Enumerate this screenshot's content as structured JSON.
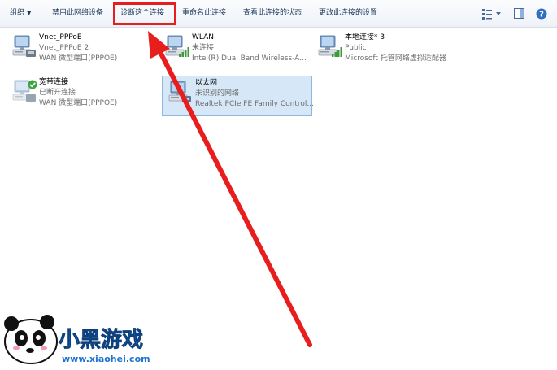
{
  "toolbar": {
    "organize": "组织",
    "disable": "禁用此网络设备",
    "diagnose": "诊断这个连接",
    "rename": "重命名此连接",
    "view_status": "查看此连接的状态",
    "change_settings": "更改此连接的设置",
    "view_caret": "▼",
    "help": "?"
  },
  "connections": [
    {
      "name": "Vnet_PPPoE",
      "status": "Vnet_PPPoE  2",
      "adapter": "WAN 微型端口(PPPOE)"
    },
    {
      "name": "WLAN",
      "status": "未连接",
      "adapter": "Intel(R) Dual Band Wireless-A..."
    },
    {
      "name": "本地连接* 3",
      "status": "Public",
      "adapter": "Microsoft 托管网络虚拟适配器"
    },
    {
      "name": "宽带连接",
      "status": "已断开连接",
      "adapter": "WAN 微型端口(PPPOE)"
    },
    {
      "name": "以太网",
      "status": "未识别的网络",
      "adapter": "Realtek PCIe FE Family Control..."
    }
  ],
  "watermark": {
    "brand": "小黑游戏",
    "url": "www.xiaohei.com"
  },
  "colors": {
    "accent": "#e81e1e",
    "selection": "#d6e7f7",
    "toolbar_text": "#1e395b"
  }
}
